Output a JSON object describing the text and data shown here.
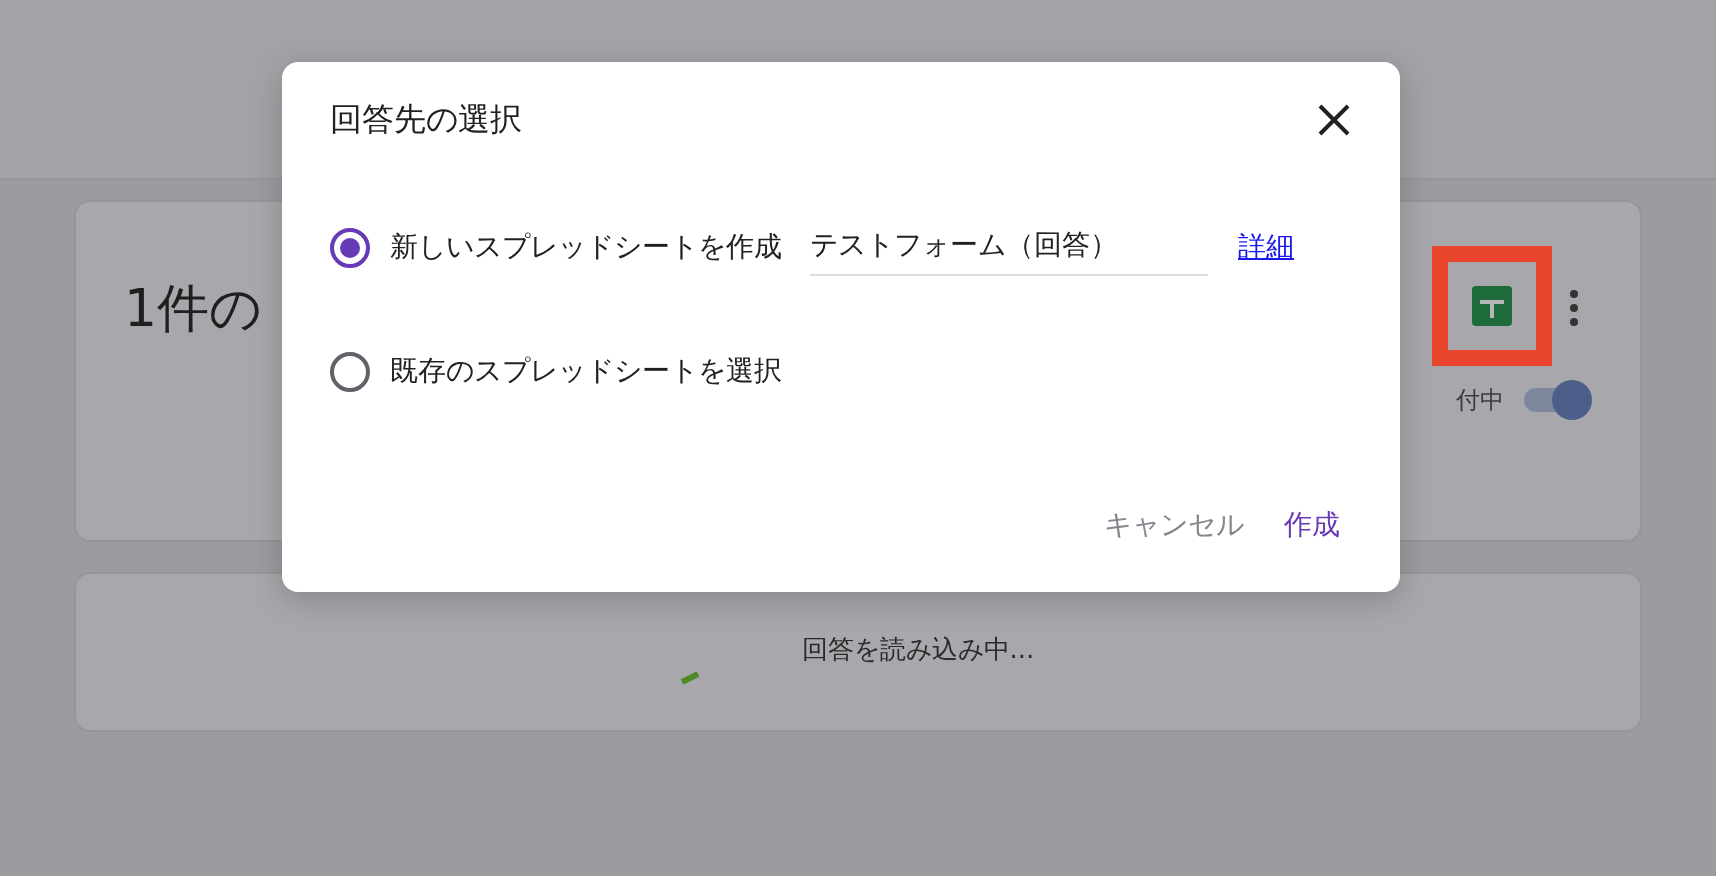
{
  "background": {
    "summary_card": {
      "title": "1件の",
      "accepting_label": "付中",
      "accepting": true
    },
    "loading": {
      "text": "回答を読み込み中..."
    }
  },
  "dialog": {
    "title": "回答先の選択",
    "options": [
      {
        "kind": "new",
        "label": "新しいスプレッドシートを作成",
        "selected": true,
        "field_value": "テストフォーム（回答）",
        "link": "詳細"
      },
      {
        "kind": "existing",
        "label": "既存のスプレッドシートを選択",
        "selected": false
      }
    ],
    "buttons": [
      {
        "kind": "cancel",
        "label": "キャンセル"
      },
      {
        "kind": "primary",
        "label": "作成"
      }
    ]
  }
}
